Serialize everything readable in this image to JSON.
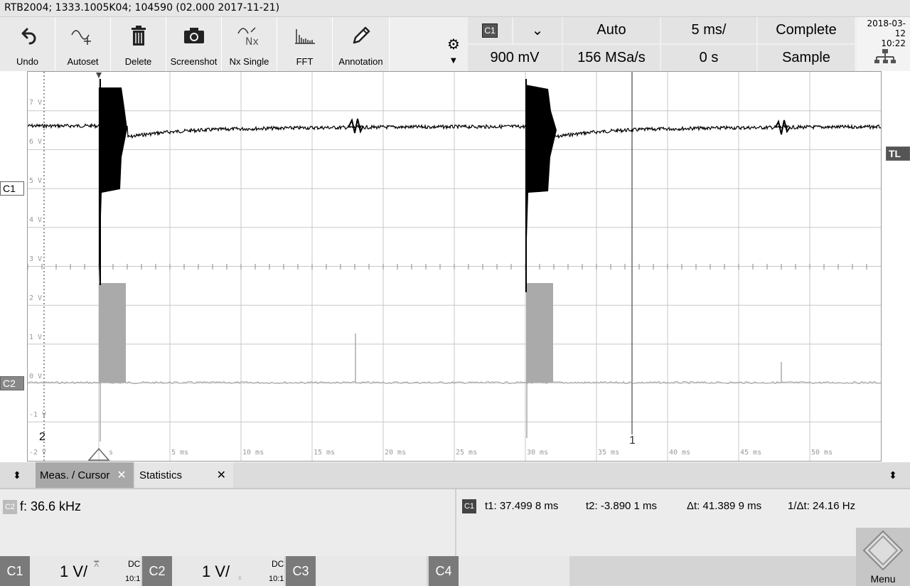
{
  "title": "RTB2004; 1333.1005K04; 104590 (02.000 2017-11-21)",
  "toolbar": {
    "undo": "Undo",
    "autoset": "Autoset",
    "delete": "Delete",
    "screenshot": "Screenshot",
    "nx_single": "Nx Single",
    "nx_icon_text": "Nx",
    "fft": "FFT",
    "annotation": "Annotation"
  },
  "trigger": {
    "source": "C1",
    "slope_glyph": "⌄",
    "mode": "Auto",
    "timebase": "5 ms/",
    "acq_mode": "Complete",
    "level": "900 mV",
    "sample_rate": "156 MSa/s",
    "position": "0 s",
    "acq_type": "Sample"
  },
  "datetime": {
    "date": "2018-03-12",
    "time": "10:22"
  },
  "markers": {
    "c1": "C1",
    "c2": "C2",
    "tl": "TL",
    "cursor1": "1",
    "cursor2": "2"
  },
  "y_axis": [
    "7 V",
    "6 V",
    "5 V",
    "4 V",
    "3 V",
    "2 V",
    "1 V",
    "0 V",
    "-1 V",
    "-2 V"
  ],
  "x_axis": [
    "s",
    "5 ms",
    "10 ms",
    "15 ms",
    "20 ms",
    "25 ms",
    "30 ms",
    "35 ms",
    "40 ms",
    "45 ms",
    "50 ms"
  ],
  "tabs": {
    "meas_cursor": "Meas. / Cursor",
    "statistics": "Statistics",
    "close": "✕"
  },
  "measurement": {
    "source": "C2",
    "text": "f: 36.6 kHz"
  },
  "cursor": {
    "source": "C1",
    "t1": "t1: 37.499 8 ms",
    "t2": "t2: -3.890 1 ms",
    "dt": "Δt: 41.389 9 ms",
    "inv_dt": "1/Δt: 24.16 Hz"
  },
  "channels": [
    {
      "name": "C1",
      "scale": "1 V/",
      "coupling": "DC",
      "probe": "10:1"
    },
    {
      "name": "C2",
      "scale": "1 V/",
      "coupling": "DC",
      "probe": "10:1"
    },
    {
      "name": "C3"
    },
    {
      "name": "C4"
    }
  ],
  "menu_label": "Menu",
  "colors": {
    "ch1": "#000000",
    "ch2": "#aaaaaa",
    "grid": "#c8c8c8"
  }
}
